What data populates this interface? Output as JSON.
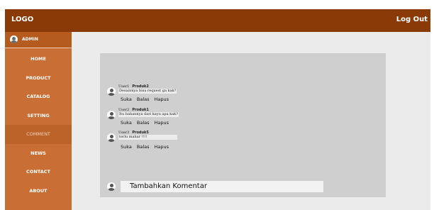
{
  "header": {
    "logo": "LOGO",
    "logout": "Log Out"
  },
  "sidebar": {
    "user": "ADMIN",
    "items": [
      {
        "label": "HOME"
      },
      {
        "label": "PRODUCT"
      },
      {
        "label": "CATALOG"
      },
      {
        "label": "SETTING"
      },
      {
        "label": "COMMENT",
        "active": true
      },
      {
        "label": "NEWS"
      },
      {
        "label": "CONTACT"
      },
      {
        "label": "ABOUT"
      }
    ]
  },
  "comments": [
    {
      "user": "User1",
      "product": "Produk2",
      "text": "Desainnya bisa request ga kak?",
      "actions": [
        "Suka",
        "Balas",
        "Hapus"
      ]
    },
    {
      "user": "User2",
      "product": "Produk1",
      "text": "Itu bahannya dari kayu apa kak?",
      "actions": [
        "Suka",
        "Balas",
        "Hapus"
      ]
    },
    {
      "user": "User3",
      "product": "Produk5",
      "text": "terlu mahar !!!!",
      "actions": [
        "Suka",
        "Balas",
        "Hapus"
      ]
    }
  ],
  "add_comment": {
    "label": "Tambahkan Komentar"
  },
  "colors": {
    "header": "#8a3a06",
    "sidebar": "#c96e34",
    "panel": "#cfcfcf"
  }
}
